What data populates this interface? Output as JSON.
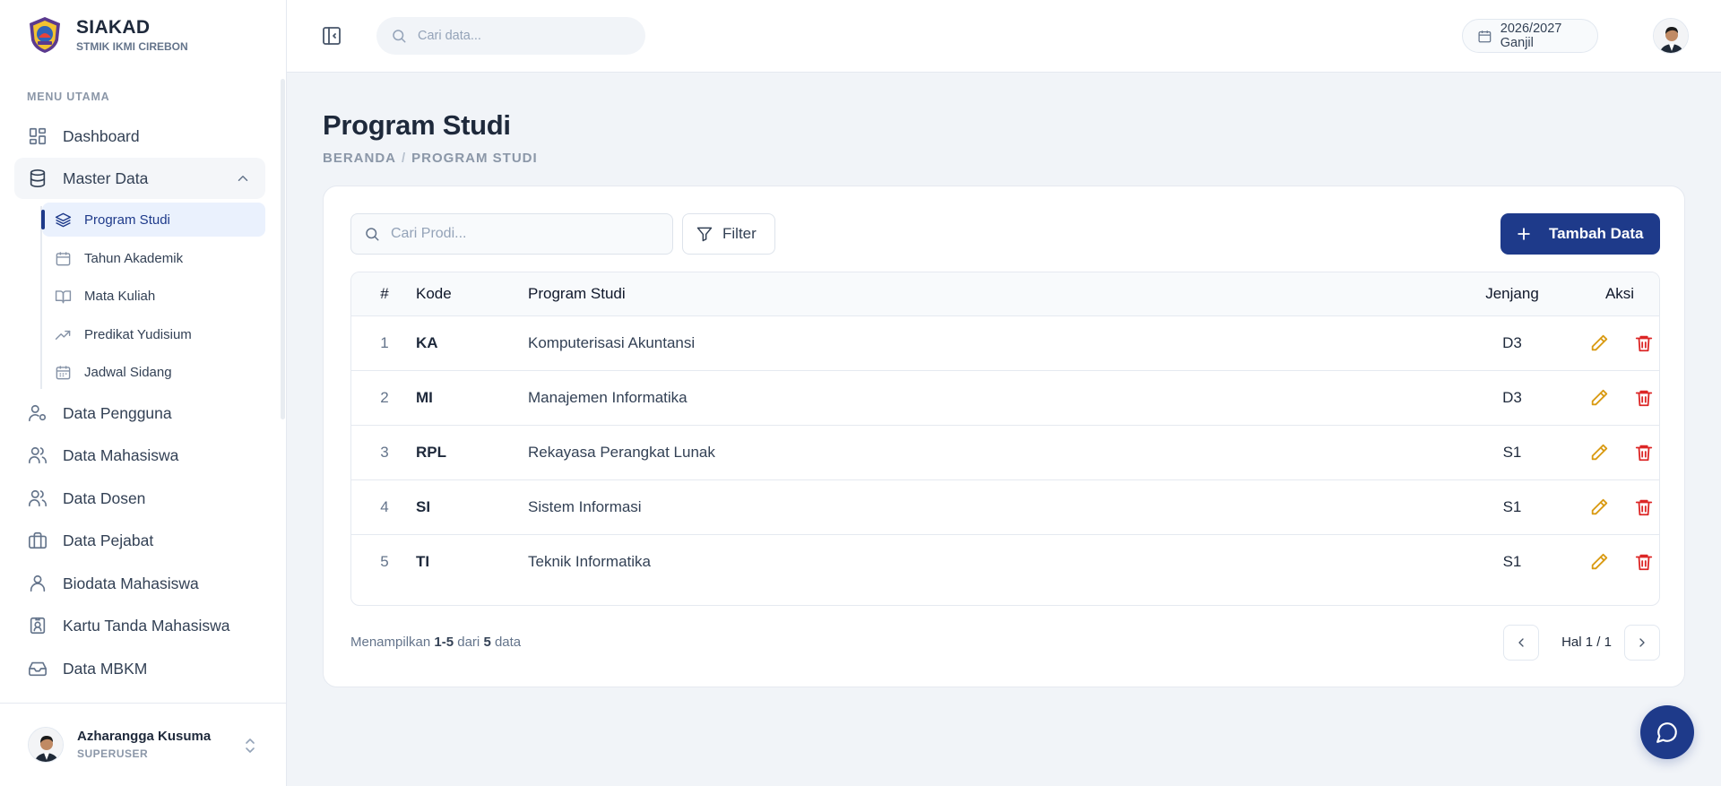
{
  "brand": {
    "title": "SIAKAD",
    "subtitle": "STMIK IKMI CIREBON"
  },
  "sidebar": {
    "section_label": "MENU UTAMA",
    "items": [
      {
        "label": "Dashboard",
        "icon": "layout-grid-icon"
      },
      {
        "label": "Master Data",
        "icon": "database-icon",
        "expanded": true,
        "children": [
          {
            "label": "Program Studi",
            "icon": "layers-icon",
            "active": true
          },
          {
            "label": "Tahun Akademik",
            "icon": "calendar-icon"
          },
          {
            "label": "Mata Kuliah",
            "icon": "book-open-icon"
          },
          {
            "label": "Predikat Yudisium",
            "icon": "trending-up-icon"
          },
          {
            "label": "Jadwal Sidang",
            "icon": "calendar-days-icon"
          }
        ]
      },
      {
        "label": "Data Pengguna",
        "icon": "user-cog-icon"
      },
      {
        "label": "Data Mahasiswa",
        "icon": "users-icon"
      },
      {
        "label": "Data Dosen",
        "icon": "users-icon"
      },
      {
        "label": "Data Pejabat",
        "icon": "briefcase-icon"
      },
      {
        "label": "Biodata Mahasiswa",
        "icon": "user-icon"
      },
      {
        "label": "Kartu Tanda Mahasiswa",
        "icon": "id-badge-icon"
      },
      {
        "label": "Data MBKM",
        "icon": "inbox-icon"
      }
    ]
  },
  "user": {
    "name": "Azharangga Kusuma",
    "role": "SUPERUSER"
  },
  "topbar": {
    "search_placeholder": "Cari data...",
    "period": "2026/2027 Ganjil"
  },
  "page": {
    "title": "Program Studi",
    "breadcrumb": [
      "BERANDA",
      "PROGRAM STUDI"
    ]
  },
  "toolbar": {
    "search_placeholder": "Cari Prodi...",
    "filter_label": "Filter",
    "add_label": "Tambah Data"
  },
  "table": {
    "headers": {
      "num": "#",
      "kode": "Kode",
      "prodi": "Program Studi",
      "jenjang": "Jenjang",
      "aksi": "Aksi"
    },
    "rows": [
      {
        "num": "1",
        "kode": "KA",
        "prodi": "Komputerisasi Akuntansi",
        "jenjang": "D3"
      },
      {
        "num": "2",
        "kode": "MI",
        "prodi": "Manajemen Informatika",
        "jenjang": "D3"
      },
      {
        "num": "3",
        "kode": "RPL",
        "prodi": "Rekayasa Perangkat Lunak",
        "jenjang": "S1"
      },
      {
        "num": "4",
        "kode": "SI",
        "prodi": "Sistem Informasi",
        "jenjang": "S1"
      },
      {
        "num": "5",
        "kode": "TI",
        "prodi": "Teknik Informatika",
        "jenjang": "S1"
      }
    ]
  },
  "footer": {
    "showing_prefix": "Menampilkan",
    "showing_range": "1-5",
    "showing_mid": "dari",
    "showing_total": "5",
    "showing_suffix": "data",
    "page_label": "Hal 1 / 1"
  },
  "colors": {
    "primary": "#1e3a8a",
    "edit": "#d99a12",
    "delete": "#dc2626",
    "background": "#f1f4f8"
  }
}
